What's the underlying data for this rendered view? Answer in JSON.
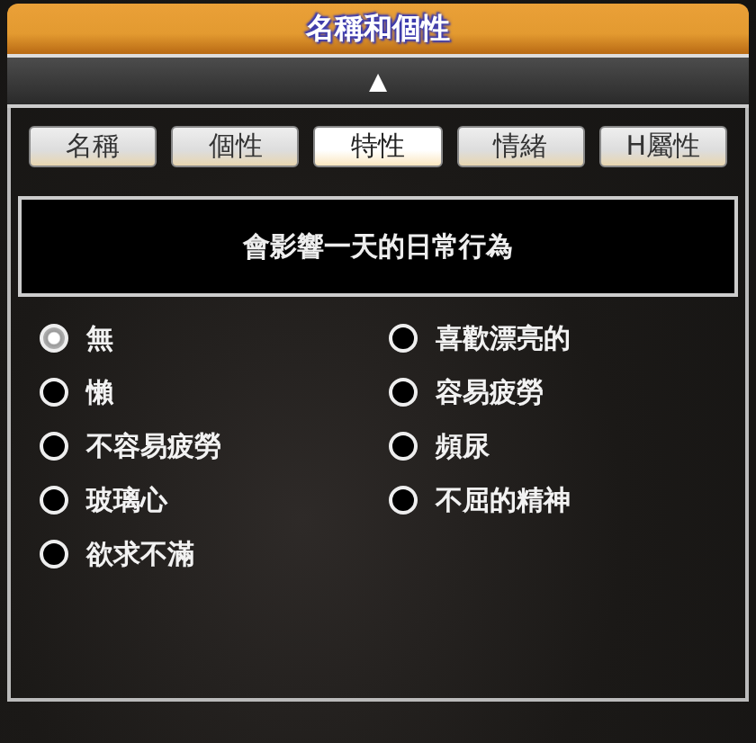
{
  "window": {
    "title": "名稱和個性"
  },
  "collapse_button": {
    "label": "▲"
  },
  "tabs": [
    {
      "label": "名稱",
      "selected": false
    },
    {
      "label": "個性",
      "selected": false
    },
    {
      "label": "特性",
      "selected": true
    },
    {
      "label": "情緒",
      "selected": false
    },
    {
      "label": "H屬性",
      "selected": false
    }
  ],
  "description": "會影響一天的日常行為",
  "options": [
    {
      "label": "無",
      "selected": true
    },
    {
      "label": "懶",
      "selected": false
    },
    {
      "label": "不容易疲勞",
      "selected": false
    },
    {
      "label": "玻璃心",
      "selected": false
    },
    {
      "label": "欲求不滿",
      "selected": false
    },
    {
      "label": "喜歡漂亮的",
      "selected": false
    },
    {
      "label": "容易疲勞",
      "selected": false
    },
    {
      "label": "頻尿",
      "selected": false
    },
    {
      "label": "不屈的精神",
      "selected": false
    }
  ]
}
